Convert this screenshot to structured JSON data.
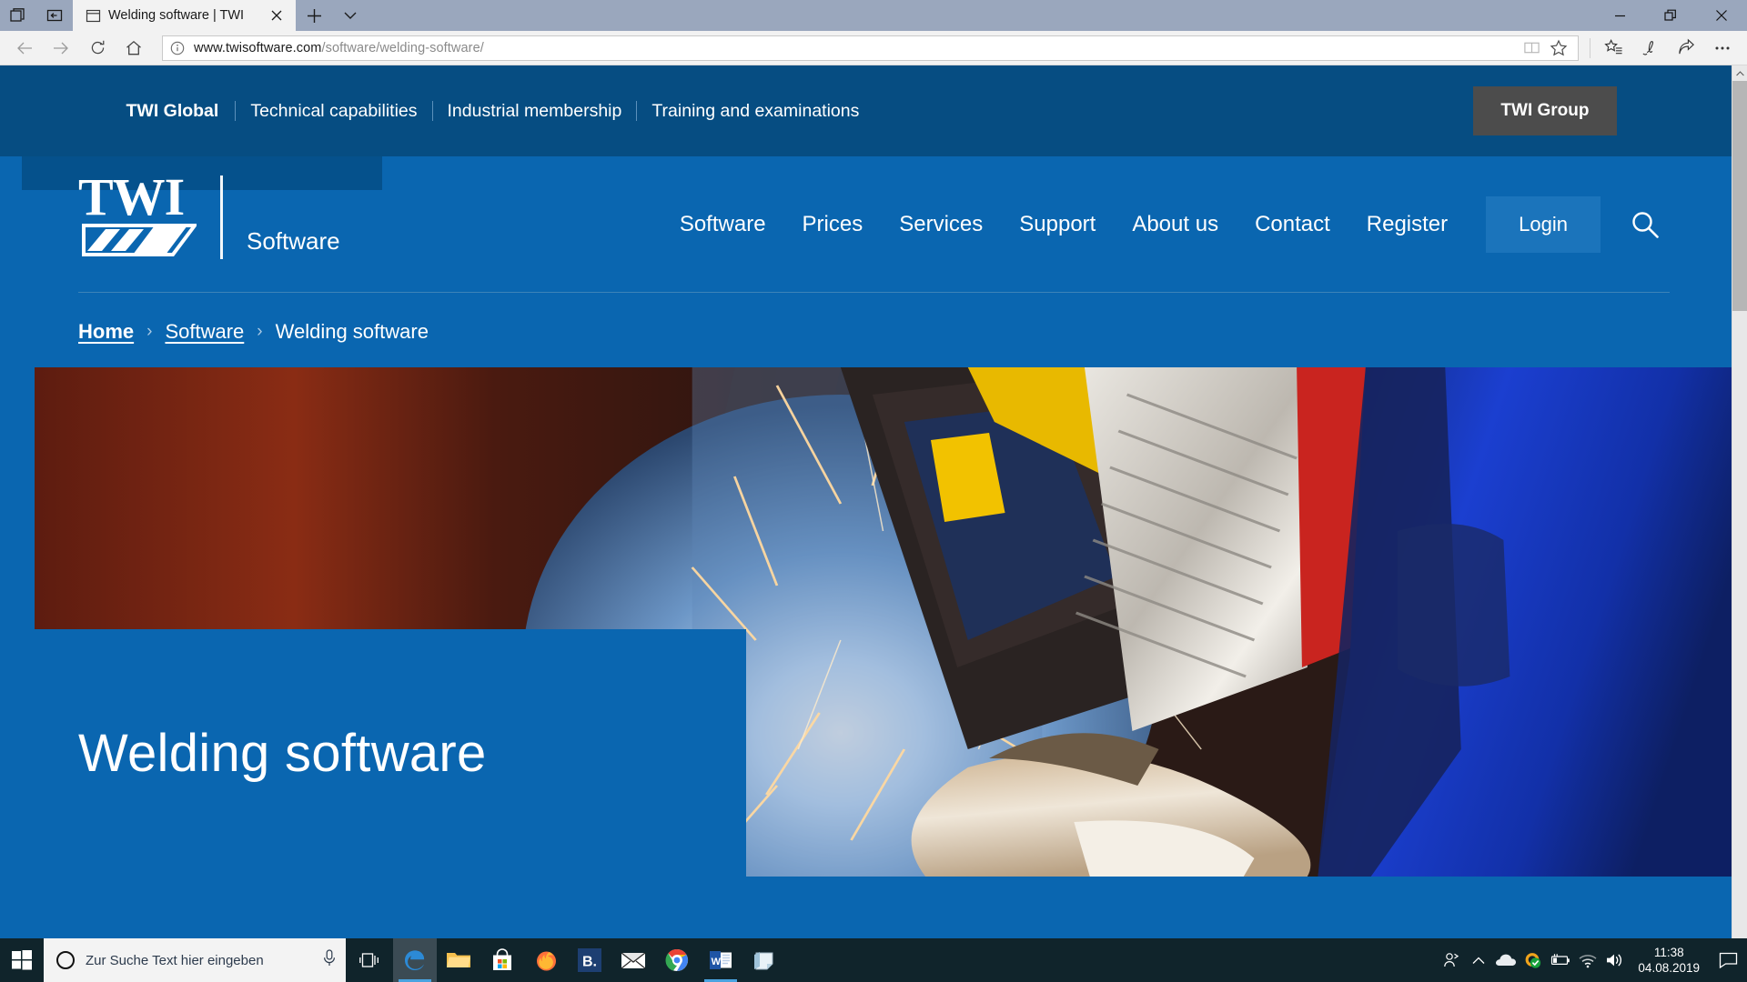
{
  "browser": {
    "tab": {
      "title": "Welding software | TWI",
      "favicon": "page-icon",
      "close": "×"
    },
    "newtab_label": "+",
    "window_controls": {
      "minimize": "—",
      "restore": "❐",
      "close": "✕"
    },
    "nav": {
      "back": "back-arrow",
      "forward": "forward-arrow",
      "refresh": "refresh-icon",
      "home": "home-icon"
    },
    "address": {
      "domain": "www.twisoftware.com",
      "path": "/software/welding-software/",
      "info_icon": "info-icon",
      "reading_view": "reading-view-icon",
      "favorite": "star-icon"
    },
    "toolbar_icons": [
      "favorites-hub-icon",
      "web-note-icon",
      "share-icon",
      "more-icon"
    ]
  },
  "site": {
    "topbar": {
      "links": [
        "TWI Global",
        "Technical capabilities",
        "Industrial membership",
        "Training and examinations"
      ],
      "group_button": "TWI Group"
    },
    "logo": {
      "mark": "TWI",
      "word": "Software"
    },
    "nav": {
      "items": [
        "Software",
        "Prices",
        "Services",
        "Support",
        "About us",
        "Contact",
        "Register"
      ],
      "login": "Login",
      "search": "search-icon"
    },
    "breadcrumb": {
      "home": "Home",
      "section": "Software",
      "separator": "›",
      "current": "Welding software"
    },
    "hero": {
      "title": "Welding software",
      "image_alt": "welder-grinding-sparks"
    }
  },
  "taskbar": {
    "start": "windows-start-icon",
    "search_placeholder": "Zur Suche Text hier eingeben",
    "cortana_icon": "cortana-ring-icon",
    "mic_icon": "microphone-icon",
    "task_view": "task-view-icon",
    "apps": [
      "edge-icon",
      "file-explorer-icon",
      "microsoft-store-icon",
      "firefox-icon",
      "blue-b-app-icon",
      "mail-icon",
      "chrome-icon",
      "word-icon",
      "sticky-notes-icon"
    ],
    "tray": [
      "people-icon",
      "show-hidden-icons-icon",
      "onedrive-icon",
      "security-check-icon",
      "battery-icon",
      "wifi-icon",
      "volume-icon"
    ],
    "clock": {
      "time": "11:38",
      "date": "04.08.2019"
    },
    "notifications": "notification-icon"
  },
  "colors": {
    "brand_blue": "#0a66b0",
    "brand_dark_blue": "#064d82",
    "login_blue": "#1b74bb",
    "group_grey": "#4c4c4c",
    "taskbar": "#10242b"
  }
}
